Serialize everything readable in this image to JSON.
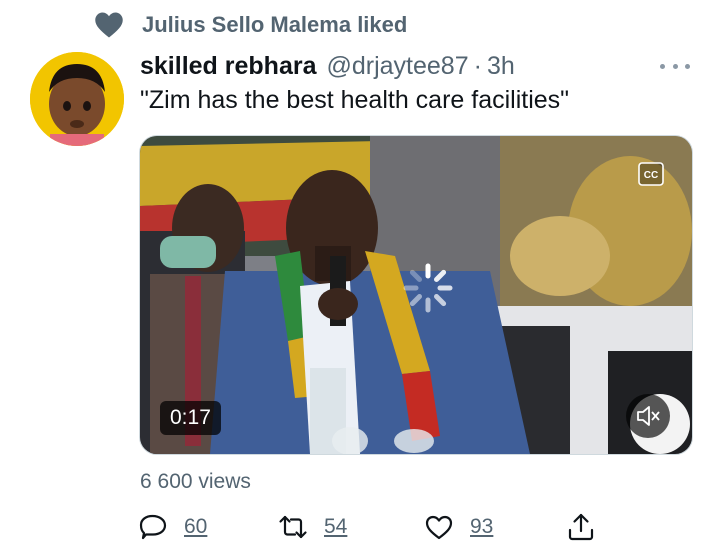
{
  "social_context": {
    "text": "Julius Sello Malema liked",
    "icon": "heart-icon"
  },
  "tweet": {
    "display_name": "skilled rebhara",
    "handle": "@drjaytee87",
    "separator": "·",
    "time": "3h",
    "text": "\"Zim has the best health care facilities\""
  },
  "media": {
    "duration": "0:17",
    "captions_icon": "closed-captions-icon",
    "mute_icon": "speaker-muted-icon",
    "state": "loading"
  },
  "views": "6 600 views",
  "actions": {
    "replies": "60",
    "retweets": "54",
    "likes": "93"
  },
  "colors": {
    "secondary_text": "#536471",
    "primary_text": "#0f1419",
    "avatar_bg": "#f2c500"
  }
}
